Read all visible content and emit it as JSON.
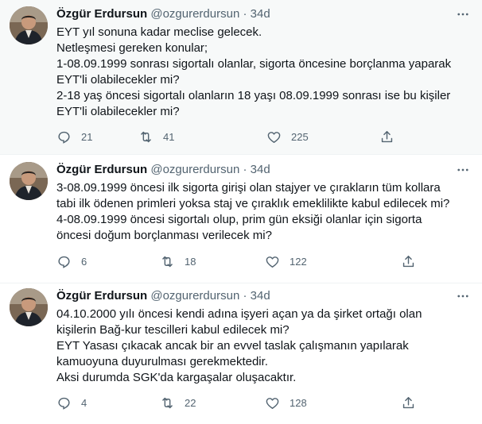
{
  "tweets": [
    {
      "name": "Özgür Erdursun",
      "handle": "@ozgurerdursun",
      "separator": "·",
      "time": "34d",
      "lines": [
        "EYT yıl sonuna kadar meclise gelecek.",
        "Netleşmesi gereken konular;",
        "1-08.09.1999 sonrası sigortalı olanlar, sigorta öncesine borçlanma yaparak",
        "EYT'li olabilecekler mi?",
        "2-18 yaş öncesi sigortalı olanların 18 yaşı 08.09.1999 sonrası ise bu kişiler",
        "EYT'li olabilecekler mi?"
      ],
      "replies": "21",
      "retweets": "41",
      "likes": "225"
    },
    {
      "name": "Özgür Erdursun",
      "handle": "@ozgurerdursun",
      "separator": "·",
      "time": "34d",
      "lines": [
        "3-08.09.1999 öncesi ilk sigorta girişi olan stajyer ve çırakların tüm kollara",
        "tabi ilk ödenen primleri yoksa staj ve çıraklık emeklilikte kabul edilecek mi?",
        "4-08.09.1999 öncesi sigortalı olup, prim gün eksiği olanlar için sigorta",
        "öncesi doğum borçlanması verilecek mi?"
      ],
      "replies": "6",
      "retweets": "18",
      "likes": "122"
    },
    {
      "name": "Özgür Erdursun",
      "handle": "@ozgurerdursun",
      "separator": "·",
      "time": "34d",
      "lines": [
        "04.10.2000 yılı öncesi kendi adına işyeri açan ya da şirket ortağı olan",
        "kişilerin Bağ-kur tescilleri kabul edilecek mi?",
        "EYT Yasası çıkacak ancak bir an evvel taslak çalışmanın yapılarak",
        "kamuoyuna duyurulması gerekmektedir.",
        "Aksi durumda SGK'da kargaşalar oluşacaktır."
      ],
      "replies": "4",
      "retweets": "22",
      "likes": "128"
    }
  ],
  "icons": {
    "more": "more-horizontal-icon",
    "reply": "reply-icon",
    "retweet": "retweet-icon",
    "like": "heart-icon",
    "share": "share-icon"
  },
  "colors": {
    "text": "#0f1419",
    "secondary": "#536471",
    "shaded_bg": "#f7f9f9",
    "divider": "#eff3f4"
  }
}
